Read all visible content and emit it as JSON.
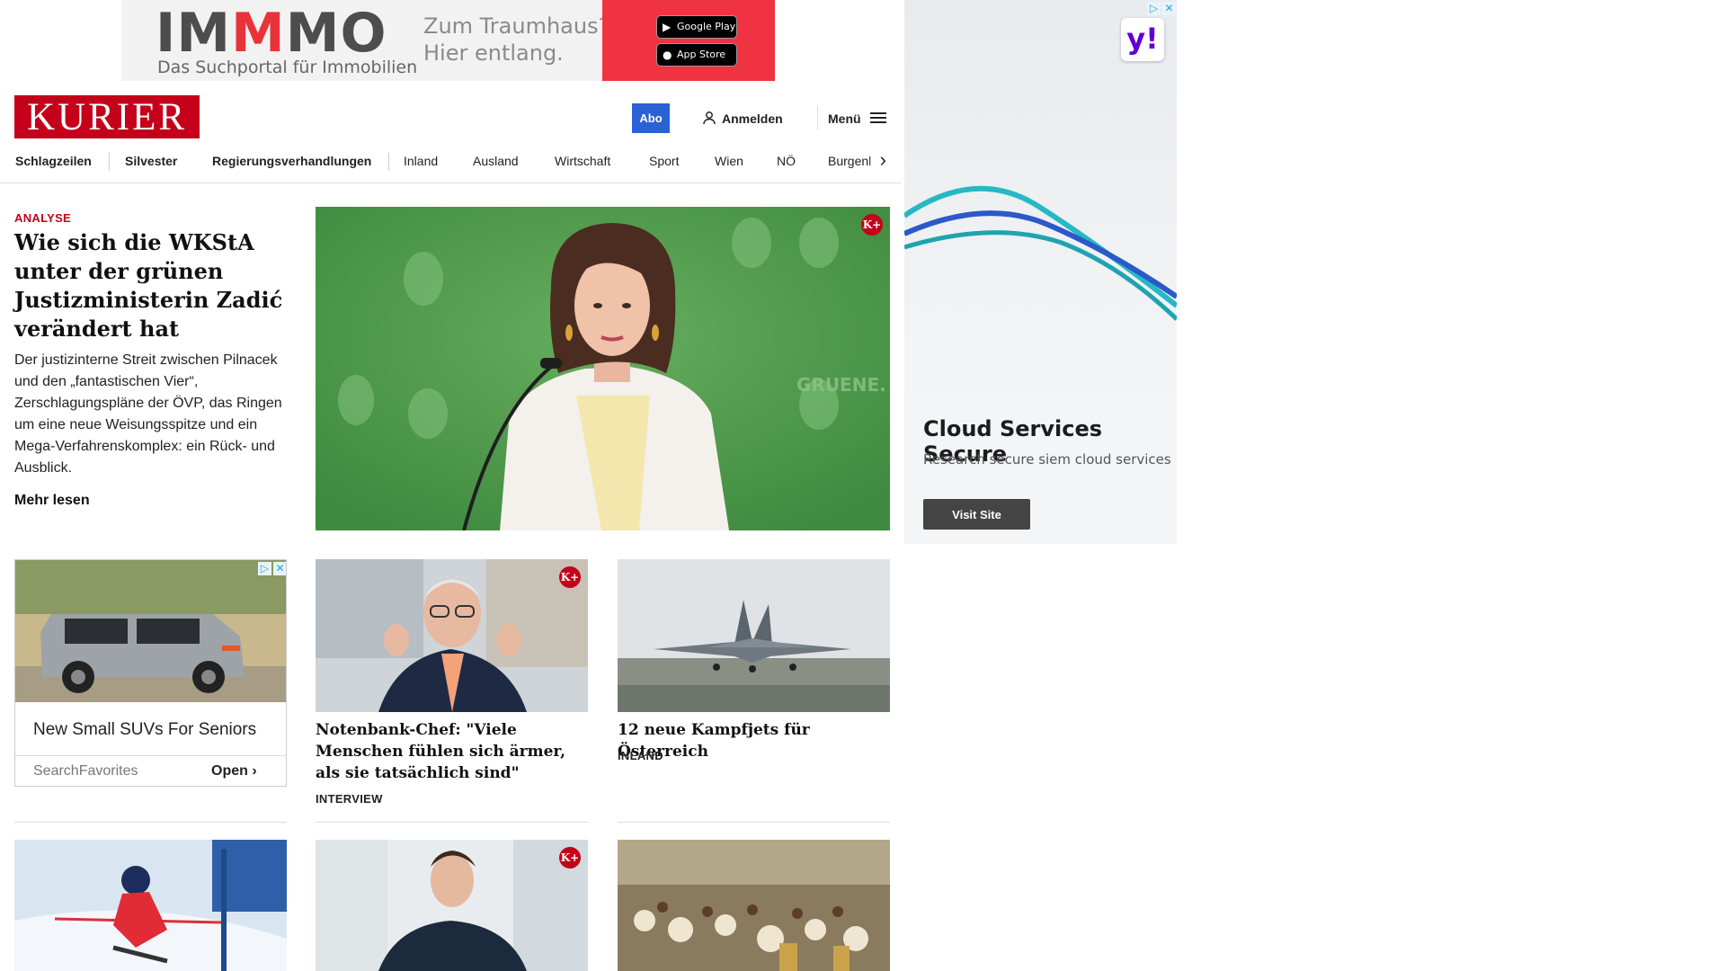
{
  "top_ad": {
    "brand_a": "IM",
    "brand_b": "M",
    "brand_c": "MO",
    "subline": "Das Suchportal für Immobilien",
    "claim_line1": "Zum Traumhaus?",
    "claim_line2": "Hier entlang.",
    "google_play": "Google Play",
    "app_store": "App Store",
    "accent_color": "#ef3340"
  },
  "header": {
    "logo": "KURIER",
    "brand_color": "#c4001a",
    "abo_label": "Abo",
    "login_label": "Anmelden",
    "menu_label": "Menü"
  },
  "nav": {
    "items": [
      {
        "label": "Schlagzeilen"
      },
      {
        "label": "Silvester"
      },
      {
        "label": "Regierungsverhandlungen"
      },
      {
        "label": "Inland"
      },
      {
        "label": "Ausland"
      },
      {
        "label": "Wirtschaft"
      },
      {
        "label": "Sport"
      },
      {
        "label": "Wien"
      },
      {
        "label": "NÖ"
      },
      {
        "label": "Burgenl"
      }
    ]
  },
  "lead": {
    "kicker": "ANALYSE",
    "title": "Wie sich die WKStA un­ter der grünen Justizmi­nisterin Zadić verändert hat",
    "teaser": "Der justizinterne Streit zwischen Pilnacek und den „fantastischen Vier“, Zerschlagungspläne der ÖVP, das Ringen um eine neue Weisungsspitze und ein Mega-Verfahrenskomplex: ein Rück- und Ausblick.",
    "more": "Mehr lesen",
    "badge": "K+",
    "image_icon": "press-conference-photo"
  },
  "car_ad": {
    "title": "New Small SUVs For Seniors",
    "source": "SearchFavorites",
    "cta": "Open"
  },
  "cards": [
    {
      "title": "Notenbank-Chef: \"Viele Menschen fühlen sich ärmer, als sie tatsäch­lich sind\"",
      "label": "INTERVIEW",
      "badge": "K+"
    },
    {
      "title": "12 neue Kampfjets für Österreich",
      "label": "INLAND"
    }
  ],
  "row2": {
    "badge": "K+"
  },
  "side_ad": {
    "title": "Cloud Services Secure",
    "description": "Research secure siem cloud services",
    "cta": "Visit Site",
    "logo": "y!"
  }
}
